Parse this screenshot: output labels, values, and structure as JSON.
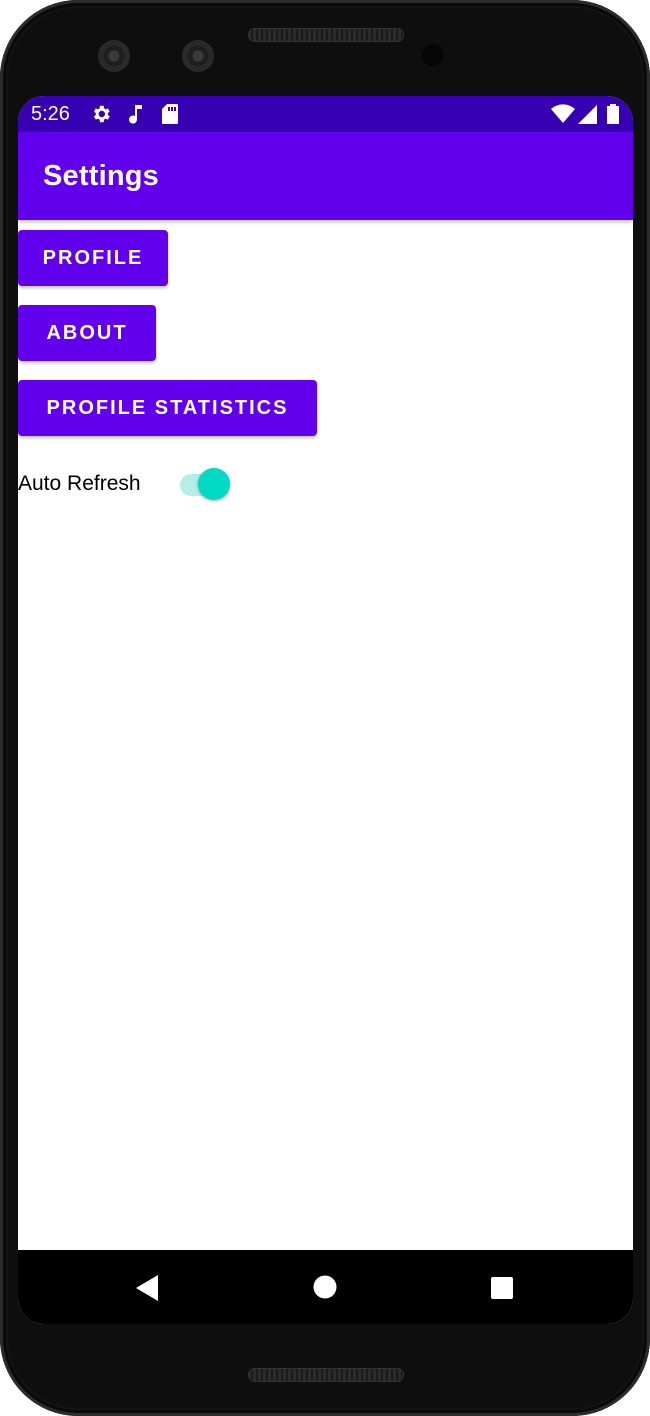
{
  "status_bar": {
    "time": "5:26",
    "left_icons": [
      "gear-icon",
      "music-note-icon",
      "sd-card-icon"
    ],
    "right_icons": [
      "wifi-icon",
      "signal-icon",
      "battery-icon"
    ]
  },
  "app_bar": {
    "title": "Settings"
  },
  "buttons": {
    "profile": "PROFILE",
    "about": "ABOUT",
    "profile_statistics": "PROFILE STATISTICS"
  },
  "auto_refresh": {
    "label": "Auto Refresh",
    "enabled": true
  },
  "nav_bar": {
    "icons": [
      "back-icon",
      "home-icon",
      "recents-icon"
    ]
  },
  "colors": {
    "status_bar": "#3700b3",
    "primary": "#6200ee",
    "accent": "#03dac5"
  }
}
